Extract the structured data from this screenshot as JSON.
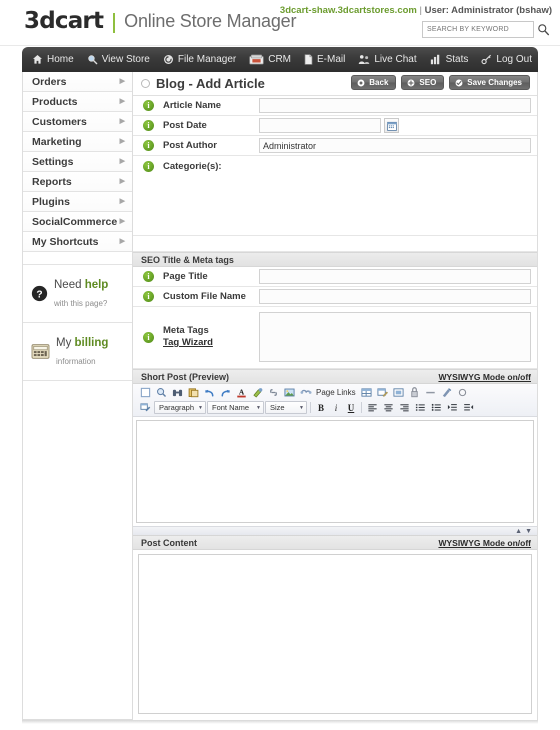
{
  "header": {
    "logo_main": "3dcart",
    "logo_sub": "Online Store Manager",
    "store_domain": "3dcart-shaw.3dcartstores.com",
    "store_separator": " | ",
    "store_user": "User: Administrator (bshaw)",
    "search_placeholder": "SEARCH BY KEYWORD",
    "search_value": "",
    "search_icon": "magnifier-icon"
  },
  "nav": {
    "items": [
      {
        "label": "Home",
        "icon": "home-icon"
      },
      {
        "label": "View Store",
        "icon": "magnifier-icon"
      },
      {
        "label": "File Manager",
        "icon": "refresh-circle-icon"
      },
      {
        "label": "CRM",
        "icon": "rolodex-icon"
      },
      {
        "label": "E-Mail",
        "icon": "document-icon"
      },
      {
        "label": "Live Chat",
        "icon": "people-icon"
      },
      {
        "label": "Stats",
        "icon": "bar-chart-icon"
      },
      {
        "label": "Log Out",
        "icon": "key-icon"
      }
    ]
  },
  "sidebar": {
    "items": [
      {
        "label": "Orders"
      },
      {
        "label": "Products"
      },
      {
        "label": "Customers"
      },
      {
        "label": "Marketing"
      },
      {
        "label": "Settings"
      },
      {
        "label": "Reports"
      },
      {
        "label": "Plugins"
      },
      {
        "label": "SocialCommerce"
      },
      {
        "label": "My Shortcuts"
      }
    ],
    "arrow_glyph": "▶",
    "help_promo": {
      "line1_plain": "Need ",
      "line1_bold": "help",
      "line2": "with this page?",
      "icon": "question-mark-circle-icon"
    },
    "billing_promo": {
      "line1_plain": "My ",
      "line1_bold": "billing",
      "line2": "information",
      "icon": "calculator-icon"
    }
  },
  "page": {
    "title": "Blog - Add Article",
    "buttons": [
      {
        "label": "Back",
        "icon": "circle-dot-icon"
      },
      {
        "label": "SEO",
        "icon": "circle-plus-icon"
      },
      {
        "label": "Save Changes",
        "icon": "circle-check-icon"
      }
    ]
  },
  "form": {
    "article_name": {
      "label": "Article Name",
      "value": "",
      "info_icon": "info-icon"
    },
    "post_date": {
      "label": "Post Date",
      "value": "",
      "info_icon": "info-icon",
      "calendar_icon": "calendar-icon"
    },
    "post_author": {
      "label": "Post Author",
      "value": "Administrator",
      "info_icon": "info-icon"
    },
    "categories": {
      "label": "Categorie(s):",
      "info_icon": "info-icon"
    }
  },
  "seo": {
    "section_title": "SEO Title & Meta tags",
    "page_title": {
      "label": "Page Title",
      "value": "",
      "info_icon": "info-icon"
    },
    "custom_file_name": {
      "label": "Custom File Name",
      "value": "",
      "info_icon": "info-icon"
    },
    "meta_tags": {
      "label_line1": "Meta Tags",
      "label_line2": "Tag Wizard",
      "value": "",
      "info_icon": "info-icon"
    }
  },
  "short_post": {
    "section_title": "Short Post (Preview)",
    "wysiwyg_toggle": "WYSIWYG Mode on/off",
    "toolbar_row1": [
      {
        "name": "new-document-icon",
        "glyph": "□"
      },
      {
        "name": "preview-magnifier-icon",
        "glyph": "⌕"
      },
      {
        "name": "find-binoculars-icon",
        "glyph": "♎"
      },
      {
        "name": "paste-clipboard-icon",
        "glyph": "⎘"
      },
      {
        "name": "undo-icon",
        "glyph": "↶"
      },
      {
        "name": "redo-icon",
        "glyph": "↷"
      },
      {
        "name": "text-color-icon",
        "glyph": "A"
      },
      {
        "name": "highlight-color-icon",
        "glyph": "✎"
      },
      {
        "name": "insert-link-icon",
        "glyph": "∞"
      },
      {
        "name": "insert-image-icon",
        "glyph": "ὛC"
      },
      {
        "name": "page-links-icon",
        "glyph": "⚭"
      }
    ],
    "toolbar_row1_label": "Page Links",
    "toolbar_row1b": [
      {
        "name": "insert-table-icon",
        "glyph": "▦"
      },
      {
        "name": "edit-table-icon",
        "glyph": "▤"
      },
      {
        "name": "table-cell-icon",
        "glyph": "▣"
      },
      {
        "name": "anchor-icon",
        "glyph": "⚓"
      },
      {
        "name": "horizontal-rule-icon",
        "glyph": "—"
      },
      {
        "name": "clean-formatting-icon",
        "glyph": "✄"
      },
      {
        "name": "help-icon",
        "glyph": "○"
      }
    ],
    "toolbar_row2": {
      "source_icon": "edit-source-icon",
      "paragraph_select": "Paragraph",
      "font_select": "Font Name",
      "size_select": "Size",
      "bold": "B",
      "italic": "i",
      "underline": "U",
      "align_left_icon": "align-left-icon",
      "align_center_icon": "align-center-icon",
      "align_right_icon": "align-right-icon",
      "ordered_list_icon": "ordered-list-icon",
      "unordered_list_icon": "unordered-list-icon",
      "indent_icon": "indent-icon",
      "outdent_icon": "outdent-icon"
    },
    "content": "",
    "scroll_up_glyph": "▲",
    "scroll_down_glyph": "▼"
  },
  "post_content": {
    "section_title": "Post Content",
    "wysiwyg_toggle": "WYSIWYG Mode on/off",
    "content": ""
  },
  "colors": {
    "brand_green": "#8fbf3f",
    "link_green": "#6c9c2f",
    "nav_dark": "#3a3a3a",
    "info_green": "#4f8a17"
  }
}
